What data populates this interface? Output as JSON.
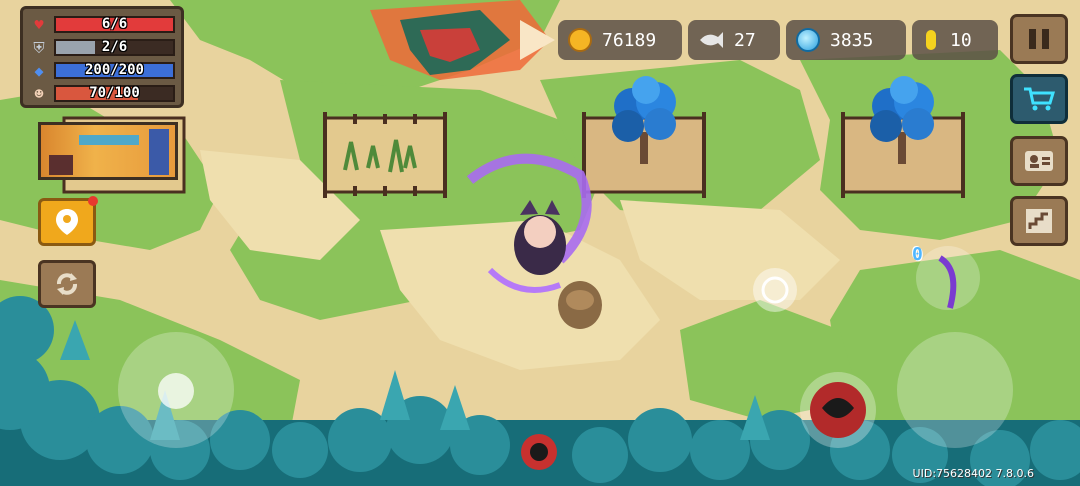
{
  "stats": [
    {
      "name": "hp",
      "icon": "heart-icon",
      "text": "6/6",
      "fraction": 1.0,
      "color": "#e23b3b"
    },
    {
      "name": "armor",
      "icon": "shield-icon",
      "text": "2/6",
      "fraction": 0.333,
      "color": "#9aa3ad"
    },
    {
      "name": "energy",
      "icon": "diamond-icon",
      "text": "200/200",
      "fraction": 1.0,
      "color": "#3c6fd8"
    },
    {
      "name": "stamina",
      "icon": "face-icon",
      "text": "70/100",
      "fraction": 0.7,
      "color": "#d9573e"
    }
  ],
  "currencies": [
    {
      "name": "gold",
      "icon": "gold-coin-icon",
      "value": "76189"
    },
    {
      "name": "fish",
      "icon": "fish-icon",
      "value": "27"
    },
    {
      "name": "gems",
      "icon": "gem-icon",
      "value": "3835"
    },
    {
      "name": "tokens",
      "icon": "token-icon",
      "value": "10"
    }
  ],
  "side_buttons": [
    "pause-icon",
    "shop-cart-icon",
    "profile-card-icon",
    "exit-stairs-icon"
  ],
  "weapon": {
    "ammo": "0"
  },
  "uid": "UID:75628402 7.8.0.6",
  "colors": {
    "grass": "#8cc452",
    "sand": "#e9d49f",
    "tree": "#2a8e9a",
    "hud": "#6b5a44"
  }
}
